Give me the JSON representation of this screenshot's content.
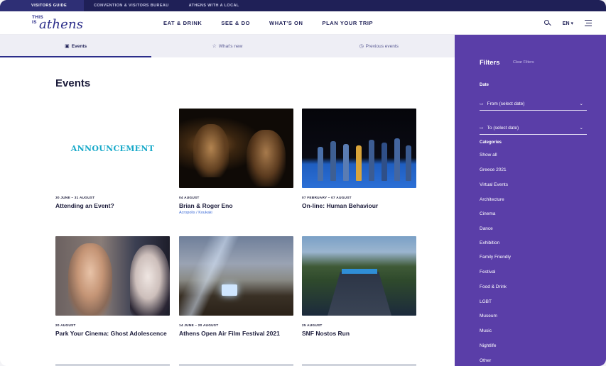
{
  "topbar": {
    "items": [
      "VISITORS GUIDE",
      "CONVENTION & VISITORS BUREAU",
      "ATHENS WITH A LOCAL"
    ]
  },
  "header": {
    "logo_small_1": "THIS",
    "logo_small_2": "IS",
    "logo_big": "athens",
    "nav": [
      "EAT & DRINK",
      "SEE & DO",
      "WHAT'S ON",
      "PLAN YOUR TRIP"
    ],
    "lang": "EN",
    "search_icon": "search-icon",
    "menu_icon": "hamburger-menu-icon"
  },
  "tabs": [
    {
      "label": "Events",
      "icon": "calendar-icon",
      "glyph": "▣"
    },
    {
      "label": "What's new",
      "icon": "star-icon",
      "glyph": "☆"
    },
    {
      "label": "Previous events",
      "icon": "clock-icon",
      "glyph": "◷"
    }
  ],
  "main": {
    "title": "Events"
  },
  "events": [
    {
      "date": "30 JUNE – 31 AUGUST",
      "title": "Attending an Event?",
      "location": "",
      "announce": "ANNOUNCEMENT"
    },
    {
      "date": "04 AUGUST",
      "title": "Brian & Roger Eno",
      "location": "Acropolis / Koukaki"
    },
    {
      "date": "07 FEBRUARY – 07 AUGUST",
      "title": "On-line: Human Behaviour",
      "location": ""
    },
    {
      "date": "20 AUGUST",
      "title": "Park Your Cinema: Ghost Adolescence",
      "location": ""
    },
    {
      "date": "14 JUNE – 20 AUGUST",
      "title": "Athens Open Air Film Festival 2021",
      "location": ""
    },
    {
      "date": "25 AUGUST",
      "title": "SNF Nostos Run",
      "location": ""
    }
  ],
  "filters": {
    "title": "Filters",
    "clear": "Clear Filters",
    "date_label": "Date",
    "from_placeholder": "From (select date)",
    "to_placeholder": "To (select date)",
    "categories_label": "Categories",
    "categories": [
      "Show all",
      "Greece 2021",
      "Virtual Events",
      "Architecture",
      "Cinema",
      "Dance",
      "Exhibition",
      "Family Friendly",
      "Festival",
      "Food & Drink",
      "LGBT",
      "Museum",
      "Music",
      "Nightlife",
      "Other"
    ]
  },
  "colors": {
    "accent": "#2b2d8a",
    "topbar": "#1f2057",
    "filters_bg": "#5a3ea8",
    "announce": "#18a9c9",
    "link": "#3d6bd6"
  }
}
